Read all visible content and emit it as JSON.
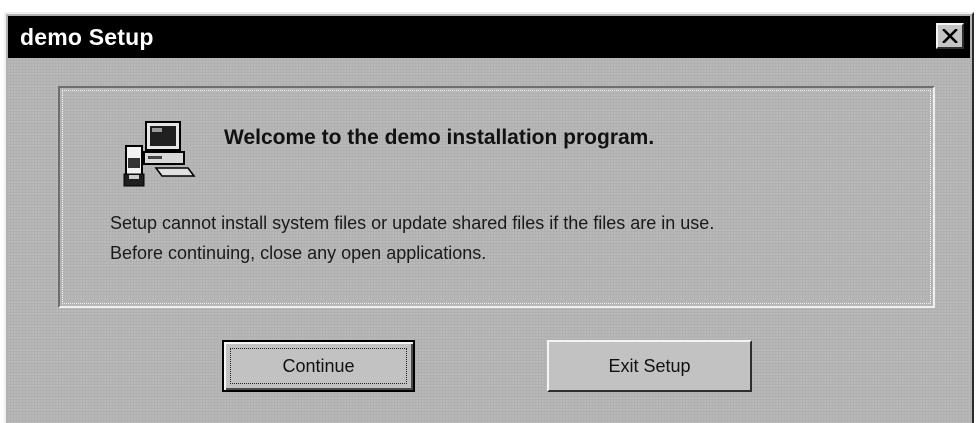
{
  "window": {
    "title": "demo Setup"
  },
  "welcome": {
    "heading": "Welcome to the demo installation program.",
    "message_line1": "Setup cannot install system files or update shared files if the files are in use.",
    "message_line2": "Before continuing, close any open applications."
  },
  "buttons": {
    "continue_label": "Continue",
    "exit_label": "Exit Setup"
  },
  "icons": {
    "close": "close-icon",
    "setup": "computer-setup-icon"
  },
  "colors": {
    "titlebar": "#000000",
    "window": "#b8b8b8",
    "text": "#111111"
  }
}
